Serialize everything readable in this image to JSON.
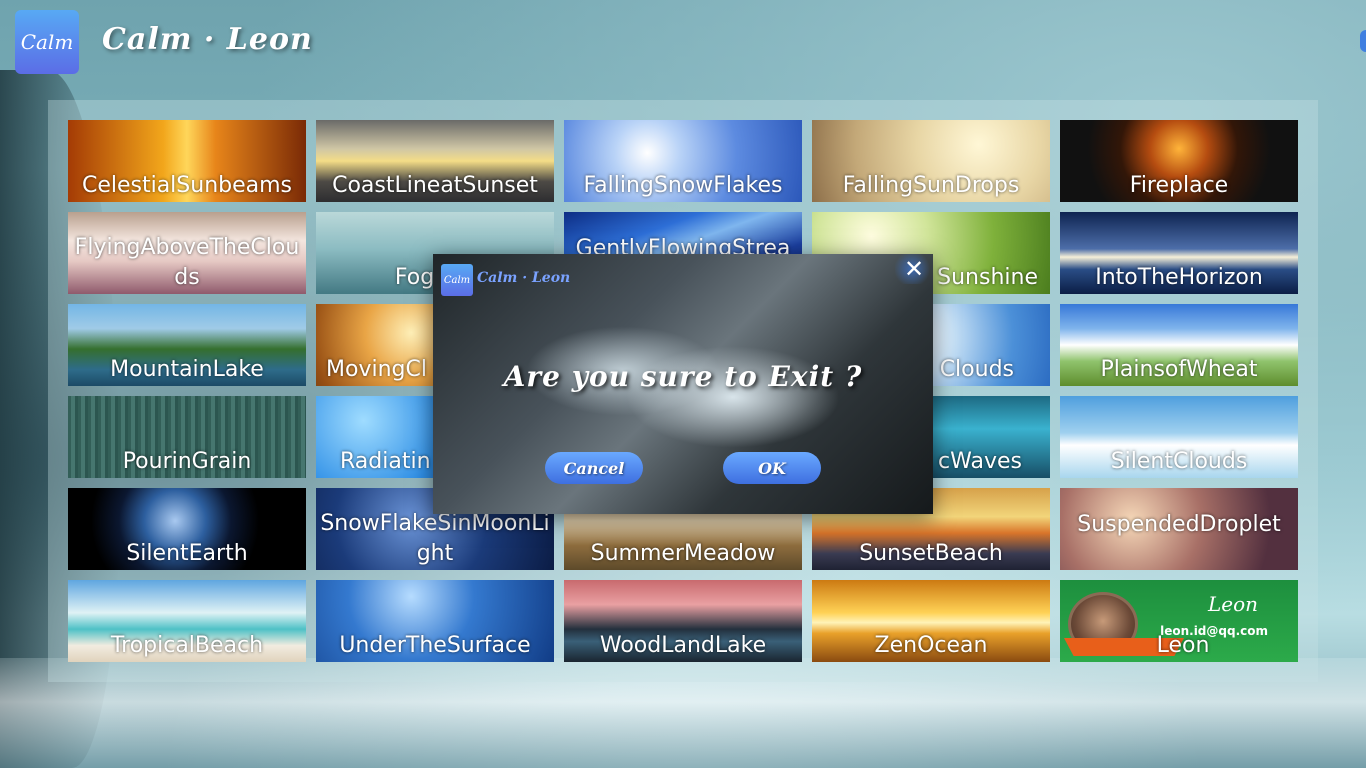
{
  "app": {
    "logo_text": "Calm",
    "title": "Calm · Leon"
  },
  "tiles": [
    "CelestialSunbeams",
    "CoastLineatSunset",
    "FallingSnowFlakes",
    "FallingSunDrops",
    "Fireplace",
    "FlyingAboveTheClouds",
    "FoggyS",
    "GentlyFlowingStrea",
    "Sunshine",
    "IntoTheHorizon",
    "MountainLake",
    "MovingCl",
    "Clouds",
    "PlainsofWheat",
    "PourinGrain",
    "Radiatin",
    "cWaves",
    "SilentClouds",
    "SilentEarth",
    "SnowFlakeSinMoonLight",
    "SummerMeadow",
    "SunsetBeach",
    "SuspendedDroplet",
    "TropicalBeach",
    "UnderTheSurface",
    "WoodLandLake",
    "ZenOcean",
    "Leon"
  ],
  "leon_card": {
    "signature": "Leon",
    "email": "leon.id@qq.com"
  },
  "dialog": {
    "logo_text": "Calm",
    "title": "Calm · Leon",
    "message": "Are you sure to Exit ?",
    "cancel_label": "Cancel",
    "ok_label": "OK",
    "close_label": "✕"
  }
}
